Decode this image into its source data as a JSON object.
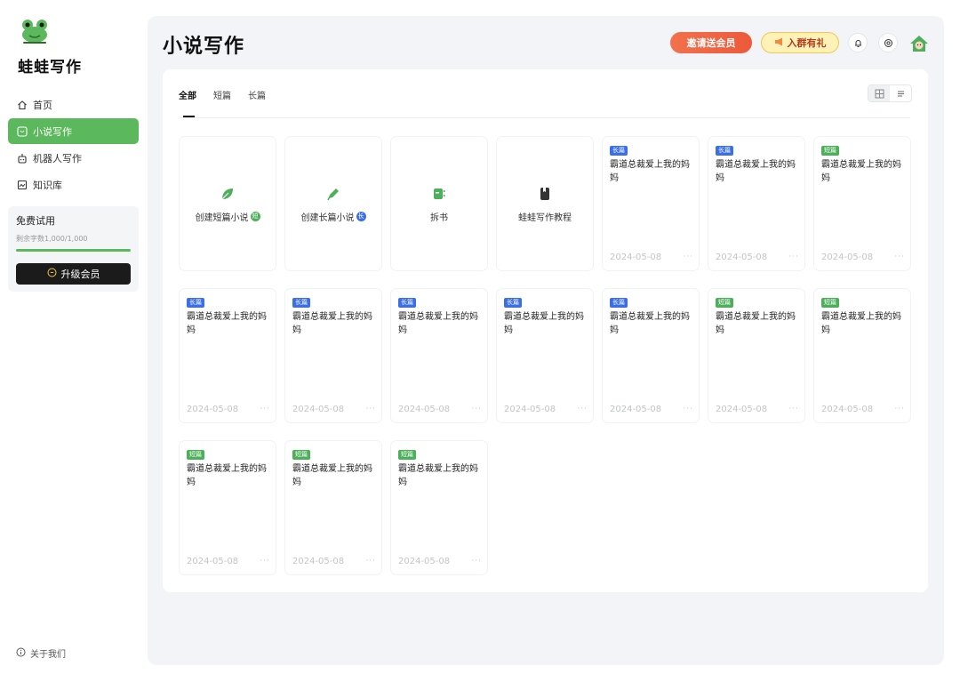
{
  "app": {
    "name": "蛙蛙写作"
  },
  "sidebar": {
    "items": [
      {
        "label": "首页",
        "icon": "home-icon"
      },
      {
        "label": "小说写作",
        "icon": "novel-icon"
      },
      {
        "label": "机器人写作",
        "icon": "robot-icon"
      },
      {
        "label": "知识库",
        "icon": "knowledge-icon"
      }
    ],
    "trial": {
      "title": "免费试用",
      "remaining": "剩余字数1,000/1,000",
      "progress": 1.0,
      "upgrade_label": "升级会员"
    },
    "about": "关于我们"
  },
  "header": {
    "title": "小说写作",
    "invite_label": "邀请送会员",
    "join_label": "入群有礼"
  },
  "tabs": [
    {
      "label": "全部"
    },
    {
      "label": "短篇"
    },
    {
      "label": "长篇"
    }
  ],
  "actions": [
    {
      "label": "创建短篇小说",
      "badge": "短",
      "icon": "leaf-icon"
    },
    {
      "label": "创建长篇小说",
      "badge": "长",
      "icon": "pen-icon"
    },
    {
      "label": "拆书",
      "icon": "split-book-icon"
    },
    {
      "label": "蛙蛙写作教程",
      "icon": "book-icon"
    }
  ],
  "cards": [
    {
      "tag": "长篇",
      "type": "long",
      "title": "霸道总裁爱上我的妈妈",
      "date": "2024-05-08",
      "more": "···"
    },
    {
      "tag": "长篇",
      "type": "long",
      "title": "霸道总裁爱上我的妈妈",
      "date": "2024-05-08",
      "more": "···"
    },
    {
      "tag": "短篇",
      "type": "short",
      "title": "霸道总裁爱上我的妈妈",
      "date": "2024-05-08",
      "more": "···"
    },
    {
      "tag": "长篇",
      "type": "long",
      "title": "霸道总裁爱上我的妈妈",
      "date": "2024-05-08",
      "more": "···"
    },
    {
      "tag": "长篇",
      "type": "long",
      "title": "霸道总裁爱上我的妈妈",
      "date": "2024-05-08",
      "more": "···"
    },
    {
      "tag": "长篇",
      "type": "long",
      "title": "霸道总裁爱上我的妈妈",
      "date": "2024-05-08",
      "more": "···"
    },
    {
      "tag": "长篇",
      "type": "long",
      "title": "霸道总裁爱上我的妈妈",
      "date": "2024-05-08",
      "more": "···"
    },
    {
      "tag": "长篇",
      "type": "long",
      "title": "霸道总裁爱上我的妈妈",
      "date": "2024-05-08",
      "more": "···"
    },
    {
      "tag": "短篇",
      "type": "short",
      "title": "霸道总裁爱上我的妈妈",
      "date": "2024-05-08",
      "more": "···"
    },
    {
      "tag": "短篇",
      "type": "short",
      "title": "霸道总裁爱上我的妈妈",
      "date": "2024-05-08",
      "more": "···"
    },
    {
      "tag": "短篇",
      "type": "short",
      "title": "霸道总裁爱上我的妈妈",
      "date": "2024-05-08",
      "more": "···"
    },
    {
      "tag": "短篇",
      "type": "short",
      "title": "霸道总裁爱上我的妈妈",
      "date": "2024-05-08",
      "more": "···"
    },
    {
      "tag": "短篇",
      "type": "short",
      "title": "霸道总裁爱上我的妈妈",
      "date": "2024-05-08",
      "more": "···"
    }
  ],
  "colors": {
    "accent": "#5cb85c",
    "long_tag": "#3b6fe6",
    "short_tag": "#4cb05a",
    "invite": "#ec5a3a"
  }
}
